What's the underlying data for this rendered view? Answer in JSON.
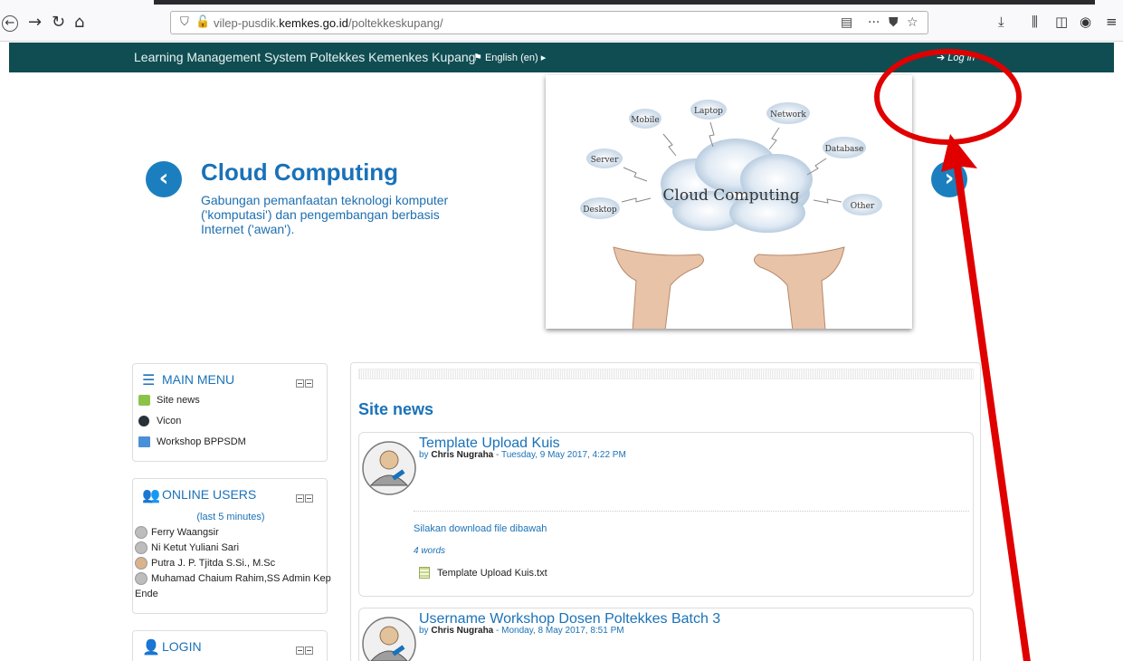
{
  "browser": {
    "url_prefix": "vilep-pusdik.",
    "url_domain": "kemkes.go.id",
    "url_path": "/poltekkeskupang/"
  },
  "navbar": {
    "site_title": "Learning Management System Poltekkes Kemenkes Kupang",
    "language": "English (en)",
    "login": "Log in"
  },
  "slider": {
    "title": "Cloud Computing",
    "description": "Gabungan pemanfaatan teknologi komputer ('komputasi') dan pengembangan berbasis Internet ('awan').",
    "image": {
      "center": "Cloud Computing",
      "tags": [
        "Mobile",
        "Laptop",
        "Network",
        "Server",
        "Database",
        "Desktop",
        "Other"
      ]
    }
  },
  "main_menu": {
    "title": "MAIN MENU",
    "items": [
      {
        "label": "Site news"
      },
      {
        "label": "Vicon"
      },
      {
        "label": "Workshop BPPSDM"
      }
    ]
  },
  "online_users": {
    "title": "ONLINE USERS",
    "subtitle": "(last 5 minutes)",
    "users": [
      {
        "name": "Ferry Waangsir"
      },
      {
        "name": "Ni Ketut Yuliani Sari"
      },
      {
        "name": "Putra J. P. Tjitda S.Si., M.Sc"
      },
      {
        "name": "Muhamad Chaium Rahim,SS Admin Kep"
      },
      {
        "name": "Ende"
      }
    ]
  },
  "login_block": {
    "title": "LOGIN"
  },
  "site_news": {
    "title": "Site news",
    "posts": [
      {
        "title": "Template Upload Kuis",
        "by": "by",
        "author": "Chris Nugraha",
        "date": "- Tuesday, 9 May 2017, 4:22 PM",
        "body": "Silakan download file dibawah",
        "words": "4 words",
        "attachment": "Template Upload Kuis.txt"
      },
      {
        "title": "Username Workshop Dosen Poltekkes Batch 3",
        "by": "by",
        "author": "Chris Nugraha",
        "date": "- Monday, 8 May 2017, 8:51 PM"
      }
    ]
  },
  "colors": {
    "navbar": "#0f4d52",
    "accent_blue": "#1a72b8",
    "annotation_red": "#e00000"
  }
}
